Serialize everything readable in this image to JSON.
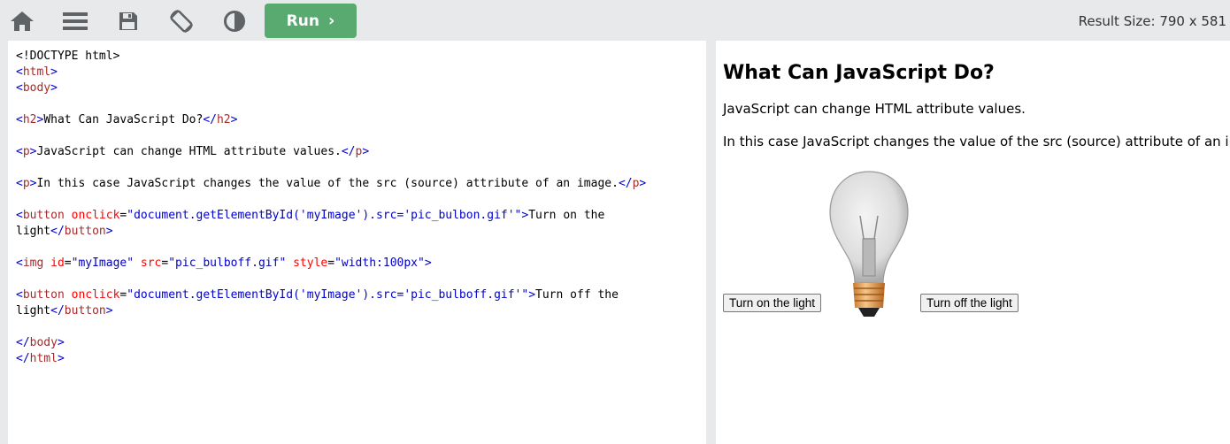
{
  "toolbar": {
    "icons": [
      "home-icon",
      "menu-icon",
      "save-icon",
      "rotate-icon",
      "contrast-icon"
    ],
    "run_label": "Run",
    "result_size": "Result Size: 790 x 581"
  },
  "code": {
    "doctype": "<!DOCTYPE html>",
    "h2_text": "What Can JavaScript Do?",
    "p1_text": "JavaScript can change HTML attribute values.",
    "p2_text": "In this case JavaScript changes the value of the src (source) attribute of an image.",
    "btn_on_onclick": "\"document.getElementById('myImage').src='pic_bulbon.gif'\"",
    "btn_on_text_a": "Turn on the",
    "btn_on_text_b": "light",
    "img_id": "\"myImage\"",
    "img_src": "\"pic_bulboff.gif\"",
    "img_style": "\"width:100px\"",
    "btn_off_onclick": "\"document.getElementById('myImage').src='pic_bulboff.gif'\"",
    "btn_off_text_a": "Turn off the",
    "btn_off_text_b": "light"
  },
  "result": {
    "heading": "What Can JavaScript Do?",
    "p1": "JavaScript can change HTML attribute values.",
    "p2": "In this case JavaScript changes the value of the src (source) attribute of an image.",
    "btn_on": "Turn on the light",
    "btn_off": "Turn off the light",
    "bulb_image": "lightbulb-off-image"
  },
  "colors": {
    "run_green": "#58aa70",
    "toolbar_bg": "#e7e9eb",
    "tag": "#a52a2a",
    "attr": "#ff0000",
    "value": "#0000cd"
  }
}
